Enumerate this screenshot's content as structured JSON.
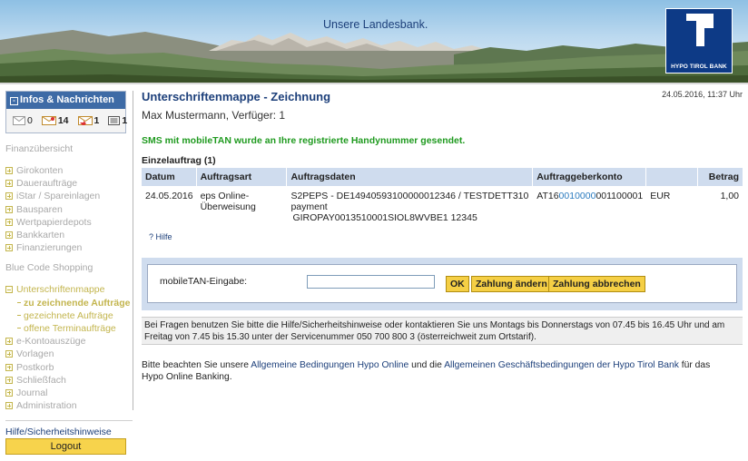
{
  "banner": {
    "tagline": "Unsere Landesbank.",
    "logo_text": "HYPO TIROL BANK"
  },
  "sidebar": {
    "info_title": "Infos & Nachrichten",
    "counts": {
      "mail": "0",
      "documents": "14",
      "alerts": "1",
      "list": "1"
    },
    "finanz_head": "Finanzübersicht",
    "items_a": [
      {
        "label": "Girokonten"
      },
      {
        "label": "Daueraufträge"
      },
      {
        "label": "iStar / Spareinlagen"
      },
      {
        "label": "Bausparen"
      },
      {
        "label": "Wertpapierdepots"
      },
      {
        "label": "Bankkarten"
      },
      {
        "label": "Finanzierungen"
      }
    ],
    "blue_code_head": "Blue Code Shopping",
    "unterschriften": "Unterschriftenmappe",
    "sub_items": [
      {
        "label": "zu zeichnende Aufträge"
      },
      {
        "label": "gezeichnete Aufträge"
      },
      {
        "label": "offene Terminaufträge"
      }
    ],
    "items_b": [
      {
        "label": "e-Kontoauszüge"
      },
      {
        "label": "Vorlagen"
      },
      {
        "label": "Postkorb"
      },
      {
        "label": "Schließfach"
      },
      {
        "label": "Journal"
      },
      {
        "label": "Administration"
      }
    ],
    "help": "Hilfe/Sicherheitshinweise",
    "logout": "Logout"
  },
  "main": {
    "title": "Unterschriftenmappe - Zeichnung",
    "timestamp": "24.05.2016, 11:37 Uhr",
    "user_line": "Max Mustermann, Verfüger: 1",
    "sms_message": "SMS mit mobileTAN wurde an Ihre registrierte Handynummer gesendet.",
    "order_heading": "Einzelauftrag (1)",
    "table": {
      "headers": [
        "Datum",
        "Auftragsart",
        "Auftragsdaten",
        "Auftraggeberkonto",
        "",
        "Betrag"
      ],
      "row": {
        "date": "24.05.2016",
        "type_line1": "eps Online-",
        "type_line2": "Überweisung",
        "data_line1": "S2PEPS - DE14940593100000012346 / TESTDETT310",
        "data_line2": "payment",
        "data_line3": "GIROPAY0013510001SIOL8WVBE1 12345",
        "account_prefix": "AT16",
        "account_highlight": "0010000",
        "account_suffix": "001100001",
        "currency": "EUR",
        "amount": "1,00"
      }
    },
    "help_question": "? Hilfe",
    "tan": {
      "label": "mobileTAN-Eingabe:",
      "value": "",
      "ok": "OK",
      "change": "Zahlung ändern",
      "cancel": "Zahlung abbrechen"
    },
    "info_text": "Bei Fragen benutzen Sie bitte die Hilfe/Sicherheitshinweise oder kontaktieren Sie uns Montags bis Donnerstags von 07.45 bis 16.45 Uhr und am Freitag von 7.45 bis 15.30 unter der Servicenummer 050 700 800 3 (österreichweit zum Ortstarif).",
    "terms": {
      "pre": "Bitte beachten Sie unsere ",
      "link1": "Allgemeine Bedingungen Hypo Online",
      "mid": " und die ",
      "link2": "Allgemeinen Geschäftsbedingungen der Hypo Tirol Bank",
      "post": " für das Hypo Online Banking."
    }
  },
  "colors": {
    "primary_blue": "#1c3f7a",
    "header_blue": "#3e6ba6",
    "table_header": "#cfdcee",
    "button_yellow": "#f5cf45",
    "success_green": "#1f9a1f",
    "nav_gold": "#c3b54e"
  }
}
